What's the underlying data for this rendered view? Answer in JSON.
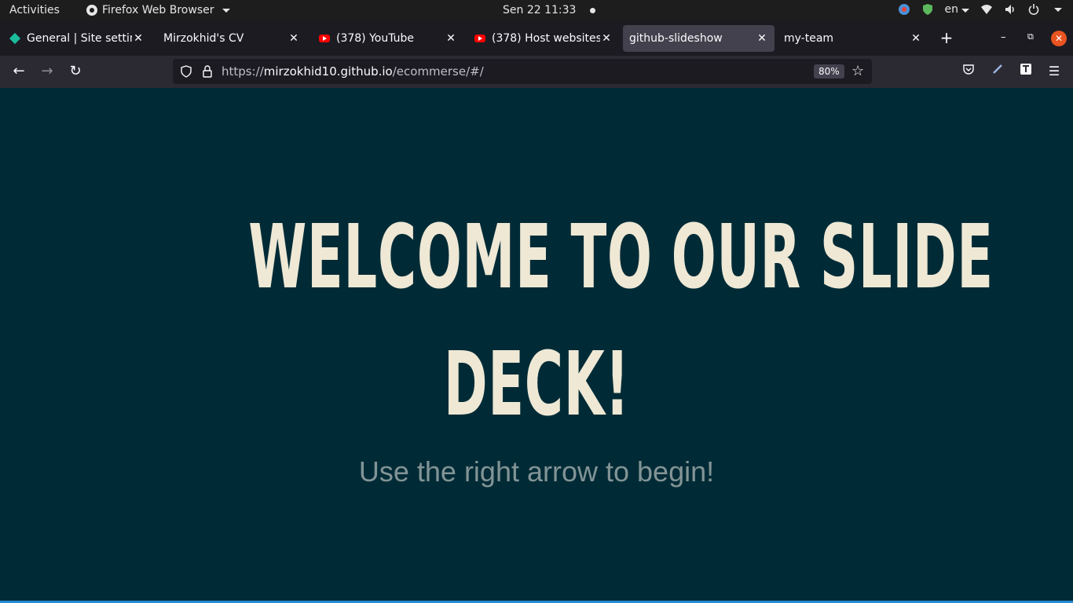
{
  "topbar": {
    "activities": "Activities",
    "app_name": "Firefox Web Browser",
    "clock": "Sen 22  11:33",
    "lang": "en"
  },
  "tabs": [
    {
      "title": "General | Site setting",
      "icon": "diamond-icon"
    },
    {
      "title": "Mirzokhid's CV",
      "icon": ""
    },
    {
      "title": "(378) YouTube",
      "icon": "youtube-icon"
    },
    {
      "title": "(378) Host websites o",
      "icon": "youtube-icon"
    },
    {
      "title": "github-slideshow",
      "icon": "",
      "active": true
    },
    {
      "title": "my-team",
      "icon": ""
    }
  ],
  "navbar": {
    "url_scheme": "https://",
    "url_host": "mirzokhid10.github.io",
    "url_path": "/ecommerse/#/",
    "zoom": "80%"
  },
  "slide": {
    "title_line1": "Welcome to our slide",
    "title_line2": "deck!",
    "subtitle": "Use the right arrow to begin!"
  },
  "colors": {
    "background": "#002b36",
    "title": "#eee8d5",
    "subtitle": "#839496",
    "accent": "#268bd2"
  }
}
